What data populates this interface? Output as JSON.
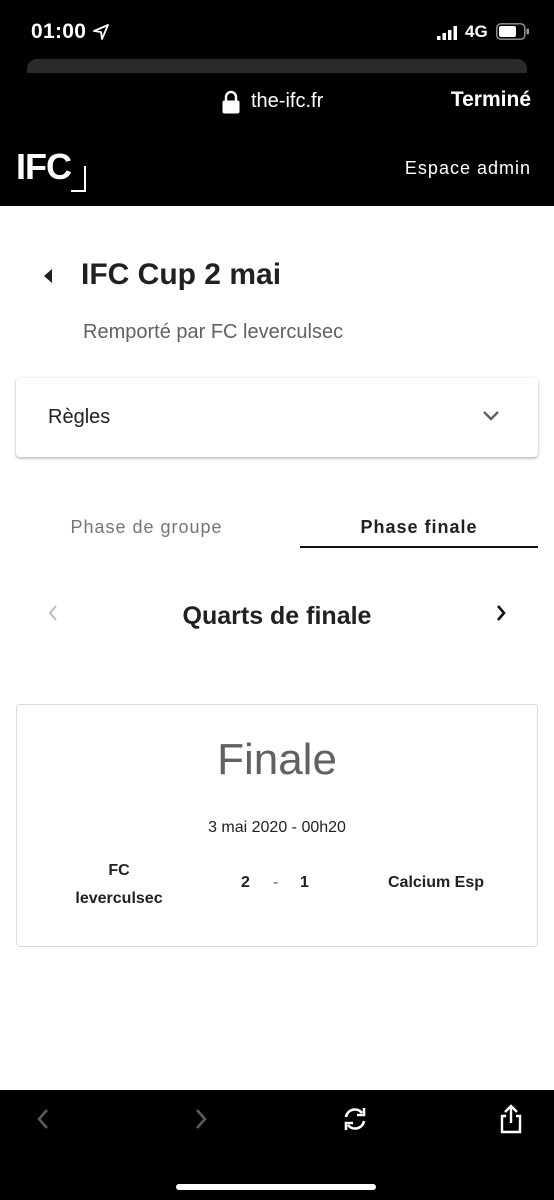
{
  "status_bar": {
    "time": "01:00",
    "network": "4G"
  },
  "browser": {
    "url": "the-ifc.fr",
    "done_label": "Terminé"
  },
  "site_header": {
    "logo": "IFC",
    "admin_link": "Espace admin"
  },
  "tournament": {
    "title": "IFC Cup 2 mai",
    "winner_text": "Remporté par FC leverculsec"
  },
  "rules_panel": {
    "label": "Règles"
  },
  "tabs": [
    {
      "label": "Phase de groupe",
      "active": false
    },
    {
      "label": "Phase finale",
      "active": true
    }
  ],
  "round_nav": {
    "title": "Quarts de finale"
  },
  "match": {
    "stage": "Finale",
    "date": "3 mai 2020 - 00h20",
    "home_team_line1": "FC",
    "home_team_line2": "leverculsec",
    "home_score": "2",
    "separator": "-",
    "away_score": "1",
    "away_team": "Calcium Esp"
  },
  "colors": {
    "header_bg": "#000000",
    "text_primary": "#212121",
    "text_secondary": "#616161",
    "tab_inactive": "#757575"
  },
  "icons": {
    "location": "location-arrow-icon",
    "signal": "signal-bars-icon",
    "battery": "battery-icon",
    "lock": "lock-icon",
    "back": "back-triangle-icon",
    "expand": "chevron-down-icon",
    "prev": "chevron-left-icon",
    "next": "chevron-right-icon",
    "reload": "reload-icon",
    "share": "share-icon"
  }
}
